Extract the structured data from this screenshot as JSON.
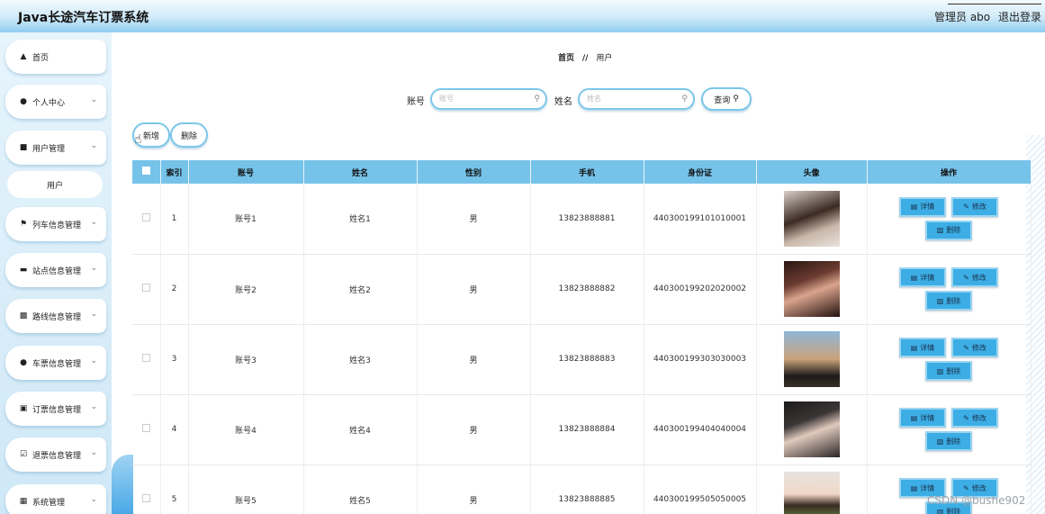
{
  "header": {
    "app_title": "Java长途汽车订票系统",
    "admin_label": "管理员 abo",
    "logout_label": "退出登录"
  },
  "sidebar": {
    "items": [
      {
        "label": "首页",
        "icon": "home-icon"
      },
      {
        "label": "个人中心",
        "icon": "user-icon"
      },
      {
        "label": "用户管理",
        "icon": "thumb-icon"
      },
      {
        "label": "列车信息管理",
        "icon": "flag-icon"
      },
      {
        "label": "站点信息管理",
        "icon": "briefcase-icon"
      },
      {
        "label": "路线信息管理",
        "icon": "bar-chart-icon"
      },
      {
        "label": "车票信息管理",
        "icon": "location-pin-icon"
      },
      {
        "label": "订票信息管理",
        "icon": "clipboard-icon"
      },
      {
        "label": "退票信息管理",
        "icon": "clipboard-check-icon"
      },
      {
        "label": "系统管理",
        "icon": "grid-icon"
      }
    ],
    "sub_item": {
      "label": "用户"
    }
  },
  "breadcrumb": {
    "home": "首页",
    "separator": "//",
    "current": "用户"
  },
  "search": {
    "account_label": "账号",
    "account_placeholder": "账号",
    "name_label": "姓名",
    "name_placeholder": "姓名",
    "query_label": "查询"
  },
  "actions": {
    "add_label": "新增",
    "delete_label": "删除"
  },
  "table": {
    "columns": [
      "索引",
      "账号",
      "姓名",
      "性别",
      "手机",
      "身份证",
      "头像",
      "操作"
    ],
    "rows": [
      {
        "index": "1",
        "account": "账号1",
        "name": "姓名1",
        "gender": "男",
        "phone": "13823888881",
        "id_card": "440300199101010001"
      },
      {
        "index": "2",
        "account": "账号2",
        "name": "姓名2",
        "gender": "男",
        "phone": "13823888882",
        "id_card": "440300199202020002"
      },
      {
        "index": "3",
        "account": "账号3",
        "name": "姓名3",
        "gender": "男",
        "phone": "13823888883",
        "id_card": "440300199303030003"
      },
      {
        "index": "4",
        "account": "账号4",
        "name": "姓名4",
        "gender": "男",
        "phone": "13823888884",
        "id_card": "440300199404040004"
      },
      {
        "index": "5",
        "account": "账号5",
        "name": "姓名5",
        "gender": "男",
        "phone": "13823888885",
        "id_card": "440300199505050005"
      }
    ],
    "row_buttons": {
      "detail": "详情",
      "edit": "修改",
      "delete": "删除"
    }
  },
  "watermark": "CSDN @bushe902",
  "colors": {
    "header_gradient_end": "#8fcdf0",
    "table_header": "#76c3ea",
    "row_button": "#3caee5",
    "input_border": "#7cc7ea"
  }
}
